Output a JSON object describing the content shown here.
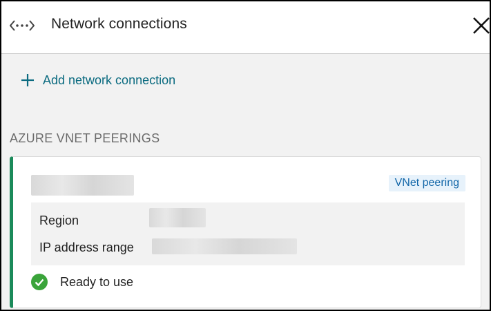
{
  "header": {
    "title": "Network connections",
    "icon": "network-connection-icon",
    "close_icon": "close-icon"
  },
  "actions": {
    "add_label": "Add network connection",
    "add_icon": "plus-icon"
  },
  "section": {
    "heading": "AZURE VNET PEERINGS"
  },
  "card": {
    "accent_color": "#1b8a5a",
    "badge": "VNet peering",
    "details": {
      "region_label": "Region",
      "ip_label": "IP address range"
    },
    "status": {
      "text": "Ready to use",
      "icon": "check-circle-icon",
      "color": "#3aa43a"
    }
  },
  "colors": {
    "link": "#0b6b80",
    "badge_bg": "#e7f2fb",
    "badge_text": "#1266a8"
  }
}
